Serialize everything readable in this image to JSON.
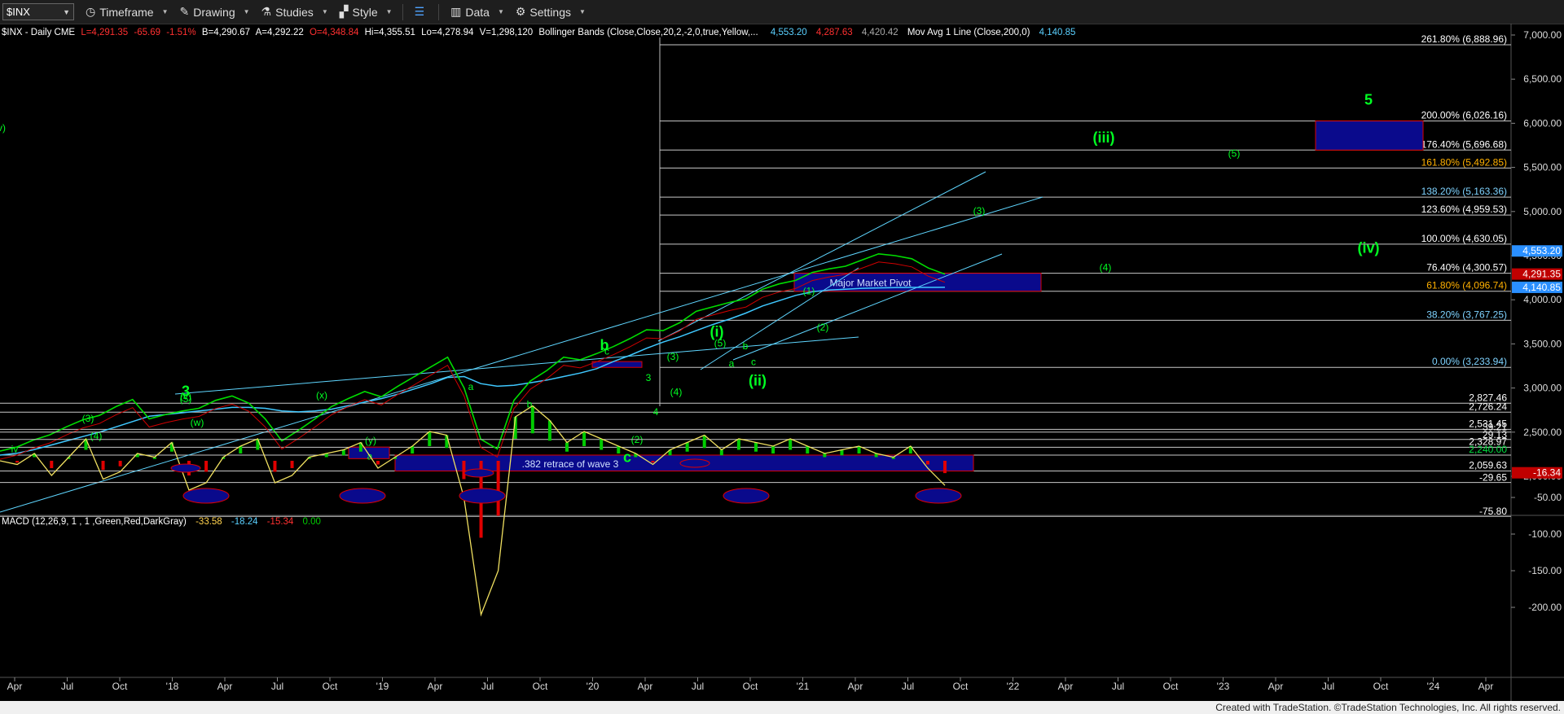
{
  "toolbar": {
    "symbol": "$INX",
    "timeframe": "Timeframe",
    "drawing": "Drawing",
    "studies": "Studies",
    "style": "Style",
    "data": "Data",
    "settings": "Settings"
  },
  "header": {
    "name": "$INX - Daily  CME",
    "L": "L=4,291.35",
    "chg": "-65.69",
    "pct": "-1.51%",
    "B": "B=4,290.67",
    "A": "A=4,292.22",
    "O": "O=4,348.84",
    "Hi": "Hi=4,355.51",
    "Lo": "Lo=4,278.94",
    "V": "V=1,298,120",
    "bb_label": "Bollinger Bands (Close,Close,20,2,-2,0,true,Yellow,...",
    "bb_upper": "4,553.20",
    "bb_lower": "4,287.63",
    "bb_mid": "4,420.42",
    "ma_label": "Mov Avg 1 Line (Close,200,0)",
    "ma_val": "4,140.85"
  },
  "macd_header": {
    "label": "MACD (12,26,9, 1 , 1 ,Green,Red,DarkGray)",
    "v1": "-33.58",
    "v2": "-18.24",
    "v3": "-15.34",
    "v4": "0.00"
  },
  "footer": "Created with TradeStation. ©TradeStation Technologies, Inc. All rights reserved.",
  "colors": {
    "up": "#00dd00",
    "down": "#e00000",
    "ma": "#3fc8ff",
    "box": "#0a0a8c",
    "label": "#00ff22"
  },
  "chart_data": {
    "type": "line",
    "title": "$INX - Daily",
    "y_ticks": [
      "7,000.00",
      "6,500.00",
      "6,000.00",
      "5,500.00",
      "5,000.00",
      "4,500.00",
      "4,000.00",
      "3,500.00",
      "3,000.00",
      "2,500.00",
      "2,000.00"
    ],
    "price_levels": [
      {
        "label": "261.80% (6,888.96)",
        "value": 6888.96
      },
      {
        "label": "200.00% (6,026.16)",
        "value": 6026.16
      },
      {
        "label": "176.40% (5,696.68)",
        "value": 5696.68
      },
      {
        "label": "161.80% (5,492.85)",
        "value": 5492.85
      },
      {
        "label": "138.20% (5,163.36)",
        "value": 5163.36
      },
      {
        "label": "123.60% (4,959.53)",
        "value": 4959.53
      },
      {
        "label": "100.00% (4,630.05)",
        "value": 4630.05
      },
      {
        "label": "76.40% (4,300.57)",
        "value": 4300.57
      },
      {
        "label": "61.80% (4,096.74)",
        "value": 4096.74
      },
      {
        "label": "38.20% (3,767.25)",
        "value": 3767.25
      },
      {
        "label": "0.00% (3,233.94)",
        "value": 3233.94
      },
      {
        "label": "2,827.46",
        "value": 2827.46
      },
      {
        "label": "2,726.24",
        "value": 2726.24
      },
      {
        "label": "2,531.45",
        "value": 2531.45
      },
      {
        "label": "2,328.97",
        "value": 2328.97
      },
      {
        "label": "2,240.00",
        "value": 2240.0
      },
      {
        "label": "2,059.63",
        "value": 2059.63
      }
    ],
    "price_tags": [
      {
        "label": "4,553.20",
        "value": 4553.2,
        "color": "#2a8fff"
      },
      {
        "label": "4,291.35",
        "value": 4291.35,
        "color": "#c00000"
      },
      {
        "label": "4,140.85",
        "value": 4140.85,
        "color": "#2a8fff"
      }
    ],
    "x_ticks": [
      "Apr",
      "Jul",
      "Oct",
      "'18",
      "Apr",
      "Jul",
      "Oct",
      "'19",
      "Apr",
      "Jul",
      "Oct",
      "'20",
      "Apr",
      "Jul",
      "Oct",
      "'21",
      "Apr",
      "Jul",
      "Oct",
      "'22",
      "Apr",
      "Jul",
      "Oct",
      "'23",
      "Apr",
      "Jul",
      "Oct",
      "'24",
      "Apr"
    ],
    "price_series": [
      2285,
      2330,
      2410,
      2470,
      2560,
      2640,
      2690,
      2790,
      2870,
      2650,
      2700,
      2740,
      2770,
      2860,
      2910,
      2830,
      2650,
      2400,
      2520,
      2650,
      2790,
      2880,
      2960,
      2900,
      3020,
      3130,
      3240,
      3350,
      3000,
      2420,
      2310,
      2860,
      3080,
      3200,
      3350,
      3320,
      3390,
      3470,
      3560,
      3660,
      3650,
      3740,
      3870,
      3920,
      3970,
      4010,
      4120,
      4180,
      4220,
      4310,
      4350,
      4380,
      4450,
      4520,
      4500,
      4465,
      4360,
      4291
    ],
    "ma200_series": [
      2240,
      2260,
      2300,
      2350,
      2400,
      2450,
      2500,
      2560,
      2620,
      2680,
      2700,
      2720,
      2740,
      2760,
      2780,
      2780,
      2770,
      2740,
      2730,
      2740,
      2760,
      2800,
      2840,
      2880,
      2930,
      2990,
      3050,
      3120,
      3130,
      3050,
      3020,
      3030,
      3060,
      3090,
      3130,
      3170,
      3220,
      3300,
      3370,
      3450,
      3520,
      3580,
      3650,
      3720,
      3780,
      3850,
      3930,
      3990,
      4050,
      4090,
      4110,
      4120,
      4130,
      4135,
      4138,
      4140,
      4140,
      4140.85
    ],
    "annotations": [
      {
        "text": "3",
        "value": 2910
      },
      {
        "text": "(v)",
        "value": 2870
      },
      {
        "text": "(5)",
        "value": 2840
      },
      {
        "text": "(3)",
        "value": 2620
      },
      {
        "text": "(4)",
        "value": 2420
      },
      {
        "text": "iv",
        "value": 2270
      },
      {
        "text": "(w)",
        "value": 2570
      },
      {
        "text": "(x)",
        "value": 2880
      },
      {
        "text": "a",
        "value": 2190
      },
      {
        "text": "(y)",
        "value": 2370
      },
      {
        "text": "b",
        "value": 3430
      },
      {
        "text": "c",
        "value": 3380
      },
      {
        "text": "a",
        "value": 2980
      },
      {
        "text": "b",
        "value": 2780
      },
      {
        "text": "c",
        "value": 2160
      },
      {
        "text": "(i)",
        "value": 3580
      },
      {
        "text": "(ii)",
        "value": 3030
      },
      {
        "text": "(3)",
        "value": 3320
      },
      {
        "text": "(4)",
        "value": 2920
      },
      {
        "text": "3",
        "value": 3080
      },
      {
        "text": "4",
        "value": 2690
      },
      {
        "text": "(2)",
        "value": 2380
      },
      {
        "text": "(5)",
        "value": 3470
      },
      {
        "text": "b",
        "value": 3440
      },
      {
        "text": "a",
        "value": 3240
      },
      {
        "text": "c",
        "value": 3260
      },
      {
        "text": "(1)",
        "value": 4060
      },
      {
        "text": "(2)",
        "value": 3650
      },
      {
        "text": "(3)",
        "value": 4970
      },
      {
        "text": "(4)",
        "value": 4330
      },
      {
        "text": "(iii)",
        "value": 5780
      },
      {
        "text": "(5)",
        "value": 5620
      },
      {
        "text": "(iv)",
        "value": 4530
      },
      {
        "text": "5",
        "value": 6210
      },
      {
        "text": "(v)",
        "value": 5910
      }
    ],
    "boxes": [
      {
        "text": ".382 retrace of wave 3",
        "low": 2059.63,
        "high": 2240
      },
      {
        "text": "Major Market Pivot",
        "low": 4096.74,
        "high": 4300.57
      },
      {
        "text": "",
        "low": 3233.94,
        "high": 3300
      }
    ],
    "macd": {
      "y_ticks": [
        "-50.00",
        "-100.00",
        "-150.00",
        "-200.00"
      ],
      "levels": [
        {
          "label": "39.21",
          "value": 39.21
        },
        {
          "label": "29.13",
          "value": 29.13
        },
        {
          "label": "-29.65",
          "value": -29.65
        },
        {
          "label": "-75.80",
          "value": -75.8
        }
      ],
      "current": {
        "label": "-16.34",
        "value": -16.34
      },
      "series": [
        0,
        -5,
        10,
        -20,
        5,
        30,
        -25,
        -15,
        10,
        5,
        25,
        -40,
        -30,
        5,
        20,
        30,
        -30,
        -20,
        5,
        10,
        15,
        25,
        -10,
        5,
        20,
        40,
        35,
        -50,
        -210,
        -150,
        60,
        75,
        55,
        25,
        40,
        30,
        20,
        10,
        -5,
        15,
        25,
        35,
        15,
        30,
        25,
        20,
        30,
        20,
        10,
        15,
        20,
        10,
        5,
        20,
        -10,
        -33.58
      ]
    }
  }
}
